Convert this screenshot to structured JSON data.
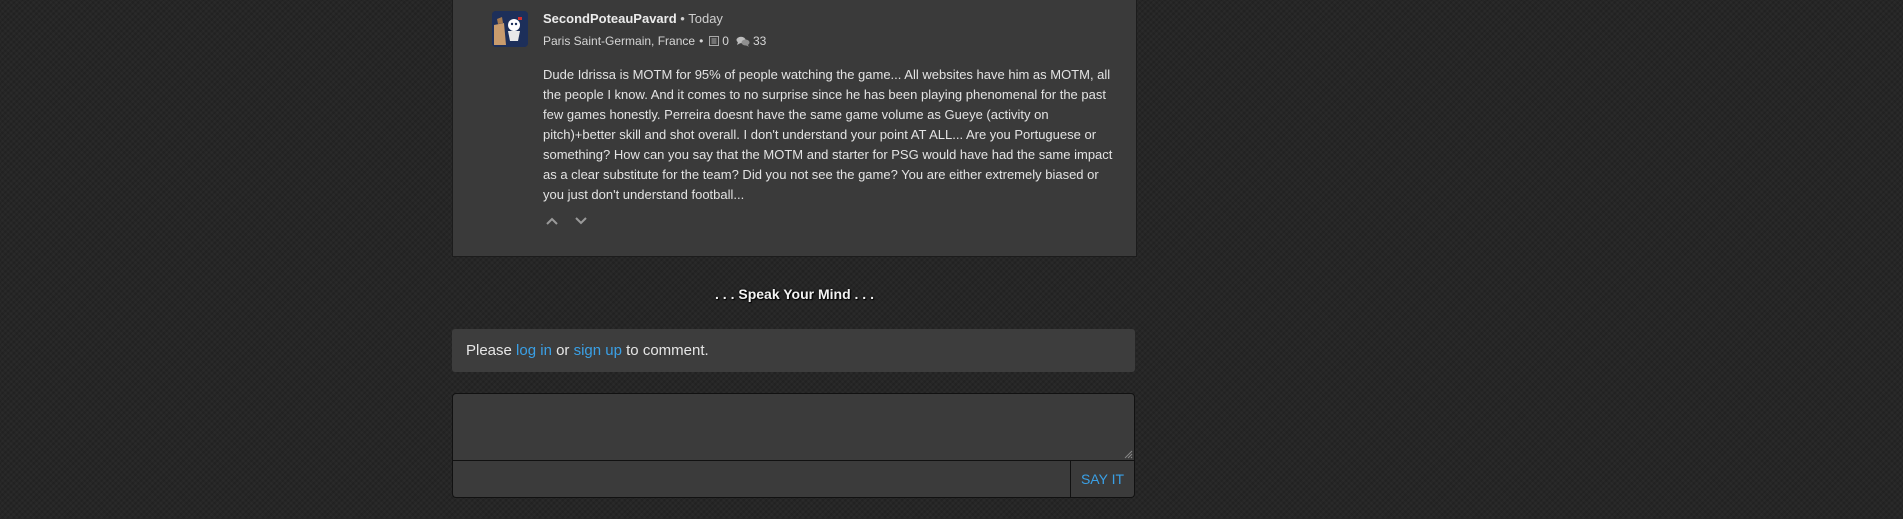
{
  "comment": {
    "username": "SecondPoteauPavard",
    "separator": "•",
    "time": "Today",
    "team": "Paris Saint-Germain, France",
    "team_separator": "•",
    "posts_count": "0",
    "comments_count": "33",
    "text": "Dude Idrissa is MOTM for 95% of people watching the game... All websites have him as MOTM, all the people I know. And it comes to no surprise since he has been playing phenomenal for the past few games honestly. Perreira doesnt have the same game volume as Gueye (activity on pitch)+better skill and shot overall. I don't understand your point AT ALL... Are you Portuguese or something? How can you say that the MOTM and starter for PSG would have had the same impact as a clear substitute for the team? Did you not see the game? You are either extremely biased or you just don't understand football..."
  },
  "speak": {
    "title": ". . . Speak Your Mind . . ."
  },
  "login_prompt": {
    "prefix": "Please",
    "login_link": "log in",
    "middle": "or",
    "signup_link": "sign up",
    "suffix": "to comment."
  },
  "composer": {
    "placeholder": "",
    "submit_label": "SAY IT"
  },
  "colors": {
    "link": "#3aa0e6",
    "panel": "#3a3a3a",
    "background": "#262626",
    "avatar_bg": "#1d2f5a"
  },
  "icons": {
    "avatar": "psg-avatar-icon",
    "posts": "document-icon",
    "comments": "speech-bubbles-icon",
    "upvote": "chevron-up-icon",
    "downvote": "chevron-down-icon"
  }
}
